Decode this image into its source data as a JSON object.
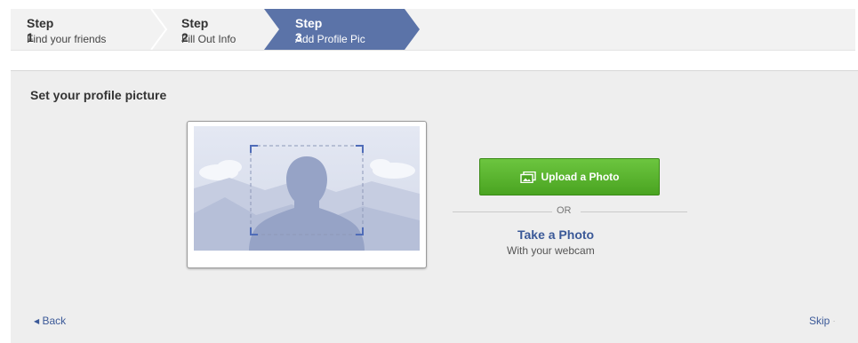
{
  "steps": [
    {
      "number": "Step 1",
      "label": "Find your friends",
      "active": false
    },
    {
      "number": "Step 2",
      "label": "Fill Out Info",
      "active": false
    },
    {
      "number": "Step 3",
      "label": "Add Profile Pic",
      "active": true
    }
  ],
  "panel": {
    "title": "Set your profile picture",
    "upload_label": "Upload a Photo",
    "or_label": "OR",
    "take_photo_label": "Take a Photo",
    "take_photo_sub": "With your webcam"
  },
  "nav": {
    "back_label": "Back",
    "skip_label": "Skip"
  },
  "colors": {
    "active_step": "#5b73a8",
    "upload_green": "#4aa421",
    "link_blue": "#3b5998"
  },
  "icons": {
    "upload": "photo-upload-icon",
    "back": "left-triangle-icon",
    "skip": "dot-icon",
    "placeholder": "silhouette-placeholder"
  }
}
